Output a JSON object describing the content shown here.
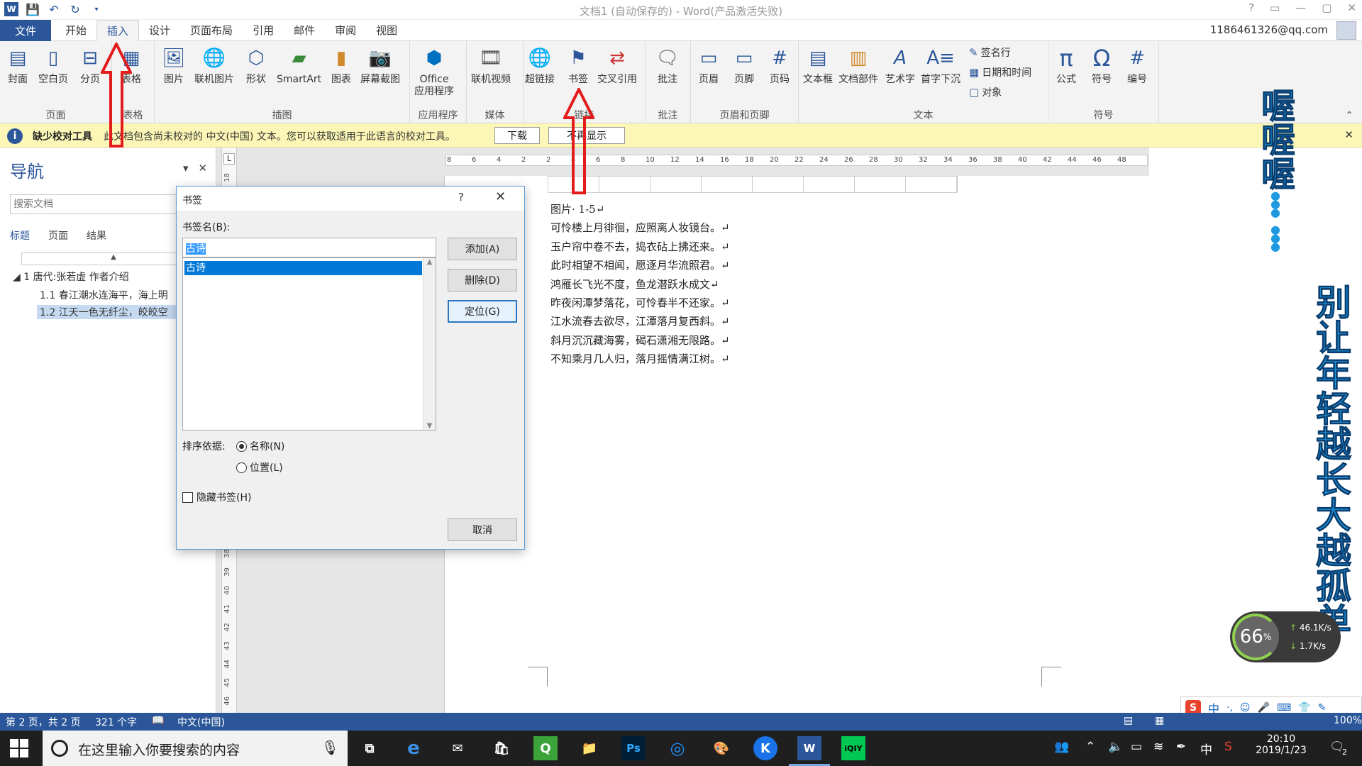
{
  "window": {
    "title": "文档1 (自动保存的) - Word(产品激活失败)",
    "account": "1186461326@qq.com",
    "help_glyph": "?",
    "controls": [
      "?",
      "▭",
      "—",
      "▢",
      "✕"
    ]
  },
  "tabs": {
    "file": "文件",
    "items": [
      "开始",
      "插入",
      "设计",
      "页面布局",
      "引用",
      "邮件",
      "审阅",
      "视图"
    ]
  },
  "ribbon": {
    "page_group": {
      "label": "页面",
      "buttons": [
        "封面",
        "空白页",
        "分页"
      ]
    },
    "table_group": {
      "label": "表格",
      "buttons": [
        "表格"
      ]
    },
    "illus_group": {
      "label": "插图",
      "buttons": [
        "图片",
        "联机图片",
        "形状",
        "SmartArt",
        "图表",
        "屏幕截图"
      ]
    },
    "apps_group": {
      "label": "应用程序",
      "buttons": [
        "Office\n应用程序"
      ]
    },
    "media_group": {
      "label": "媒体",
      "buttons": [
        "联机视频"
      ]
    },
    "links_group": {
      "label": "链接",
      "buttons": [
        "超链接",
        "书签",
        "交叉引用"
      ]
    },
    "comment_group": {
      "label": "批注",
      "buttons": [
        "批注"
      ]
    },
    "hf_group": {
      "label": "页眉和页脚",
      "buttons": [
        "页眉",
        "页脚",
        "页码"
      ]
    },
    "text_group": {
      "label": "文本",
      "buttons": [
        "文本框",
        "文档部件",
        "艺术字",
        "首字下沉"
      ],
      "small": [
        "签名行",
        "日期和时间",
        "对象"
      ]
    },
    "symbol_group": {
      "label": "符号",
      "buttons": [
        "公式",
        "符号",
        "编号"
      ]
    }
  },
  "msgbar": {
    "title": "缺少校对工具",
    "text": "此文档包含尚未校对的 中文(中国) 文本。您可以获取适用于此语言的校对工具。",
    "download": "下载",
    "dont_show": "不再显示"
  },
  "nav": {
    "title": "导航",
    "search_placeholder": "搜索文档",
    "tabs": [
      "标题",
      "页面",
      "结果"
    ],
    "items": [
      "1 唐代:张若虚 作者介绍",
      "1.1 春江潮水连海平，海上明",
      "1.2 江天一色无纤尘，皎皎空"
    ]
  },
  "ruler": {
    "h_ticks": [
      "8",
      "6",
      "4",
      "2",
      "2",
      "4",
      "6",
      "8",
      "10",
      "12",
      "14",
      "16",
      "18",
      "20",
      "22",
      "24",
      "26",
      "28",
      "30",
      "32",
      "34",
      "36",
      "38",
      "40",
      "42",
      "44",
      "46",
      "48"
    ],
    "v_ticks": [
      "18",
      "38",
      "39",
      "40",
      "41",
      "42",
      "43",
      "44",
      "45",
      "46"
    ]
  },
  "document": {
    "caption": "图片· 1-5↵",
    "lines": [
      "可怜楼上月徘徊，应照离人妆镜台。↵",
      "玉户帘中卷不去，捣衣砧上拂还来。↵",
      "此时相望不相闻，愿逐月华流照君。↵",
      "鸿雁长飞光不度，鱼龙潜跃水成文↵",
      "昨夜闲潭梦落花，可怜春半不还家。↵",
      "江水流春去欲尽，江潭落月复西斜。↵",
      "斜月沉沉藏海雾，碣石潇湘无限路。↵",
      "不知乘月几人归，落月摇情满江树。↵"
    ]
  },
  "dialog": {
    "title": "书签",
    "help": "?",
    "name_label": "书签名(B):",
    "input_value": "古诗",
    "list_items": [
      "古诗"
    ],
    "add": "添加(A)",
    "delete": "删除(D)",
    "goto": "定位(G)",
    "sort_label": "排序依据:",
    "sort_name": "名称(N)",
    "sort_position": "位置(L)",
    "hidden_label": "隐藏书签(H)",
    "cancel": "取消"
  },
  "deco": {
    "top_text": "喔喔喔",
    "side_text": "别让年轻越长大越孤单"
  },
  "speed": {
    "percent": "66",
    "pct_sign": "%",
    "up": "46.1K/s",
    "down": "1.7K/s"
  },
  "status": {
    "page": "第 2 页，共 2 页",
    "words": "321 个字",
    "lang": "中文(中国)",
    "zoom": "100%"
  },
  "taskbar": {
    "search_text": "在这里输入你要搜索的内容",
    "time": "20:10",
    "date": "2019/1/23",
    "ime": "中",
    "notif_count": "2"
  },
  "ime_bar": [
    "中",
    "·,",
    "☺",
    "🎤",
    "⌨",
    "👕",
    "✎"
  ]
}
